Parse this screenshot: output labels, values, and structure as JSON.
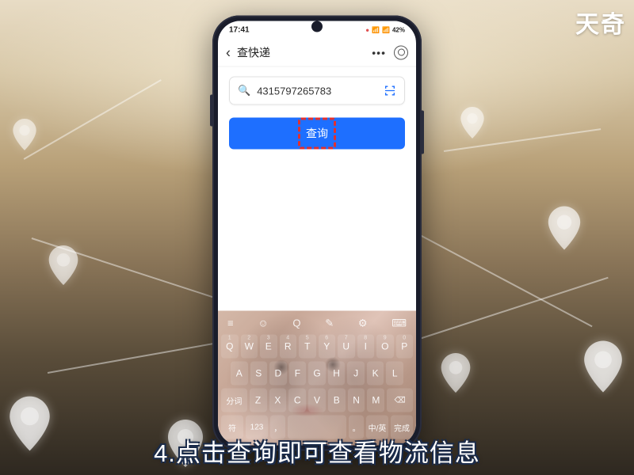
{
  "watermark": "天奇",
  "caption": "4.点击查询即可查看物流信息",
  "status": {
    "time": "17:41",
    "rec_icon": "●",
    "battery": "42%"
  },
  "nav": {
    "back": "‹",
    "title": "查快递",
    "more": "•••"
  },
  "search": {
    "value": "4315797265783"
  },
  "button": {
    "query": "查询"
  },
  "keyboard": {
    "top": [
      "≡",
      "☺",
      "Q",
      "✎",
      "⚙",
      "⌨"
    ],
    "nums": [
      "1",
      "2",
      "3",
      "4",
      "5",
      "6",
      "7",
      "8",
      "9",
      "0"
    ],
    "row1": [
      "Q",
      "W",
      "E",
      "R",
      "T",
      "Y",
      "U",
      "I",
      "O",
      "P"
    ],
    "row2": [
      "A",
      "S",
      "D",
      "F",
      "G",
      "H",
      "J",
      "K",
      "L"
    ],
    "shift": "分词",
    "row3": [
      "Z",
      "X",
      "C",
      "V",
      "B",
      "N",
      "M"
    ],
    "del": "⌫",
    "bottom": {
      "sym": "符",
      "lang": "123",
      "comma": "，",
      "space": "",
      "period": "。",
      "ime": "中/英",
      "done": "完成"
    }
  }
}
